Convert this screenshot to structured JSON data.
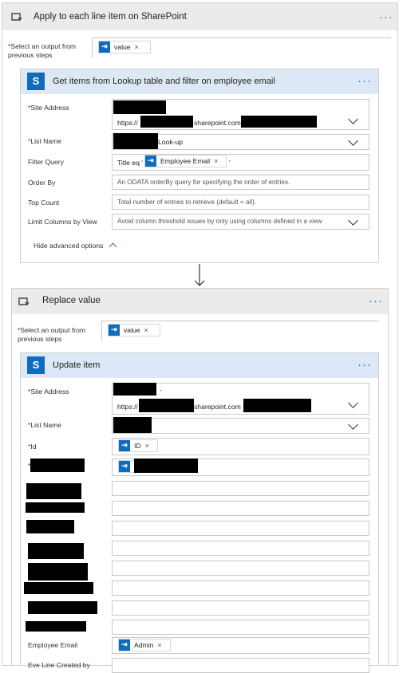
{
  "apply_loop": {
    "title": "Apply to each line item on SharePoint",
    "more_icon": "ellipsis-icon",
    "loop_icon": "loop-icon",
    "select_output": {
      "label": "Select an output from previous steps",
      "token": "value"
    }
  },
  "get_items": {
    "title": "Get items from Lookup table and filter on employee email",
    "icon": "sharepoint-icon",
    "site_address": {
      "label": "Site Address",
      "prefix": "https://",
      "suffix": "sharepoint.com"
    },
    "list_name": {
      "label": "List Name",
      "value": "Look-up"
    },
    "filter_query": {
      "label": "Filter Query",
      "value_prefix": "Title eq '",
      "token": "Employee Email",
      "value_suffix": "'"
    },
    "order_by": {
      "label": "Order By",
      "placeholder": "An ODATA orderBy query for specifying the order of entries."
    },
    "top_count": {
      "label": "Top Count",
      "placeholder": "Total number of entries to retrieve (default = all)."
    },
    "limit_columns": {
      "label": "Limit Columns by View",
      "placeholder": "Avoid column threshold issues by only using columns defined in a view"
    },
    "hide_advanced": "Hide advanced options"
  },
  "replace_loop": {
    "title": "Replace value",
    "select_output": {
      "label": "Select an output from previous steps",
      "token": "value"
    }
  },
  "update_item": {
    "title": "Update item",
    "site_address": {
      "label": "Site Address",
      "prefix": "https://",
      "suffix": "sharepoint.com",
      "dash": "-"
    },
    "list_name": {
      "label": "List Name"
    },
    "id": {
      "label": "Id",
      "token": "ID"
    },
    "employee_email": {
      "label": "Employee Email",
      "token": "Admin"
    },
    "partial_label": "Eve Line Created by"
  },
  "colors": {
    "accent": "#0f6cbd",
    "loop_header": "#ebebeb",
    "action_header": "#dce8f5",
    "required": "#cc0000"
  }
}
